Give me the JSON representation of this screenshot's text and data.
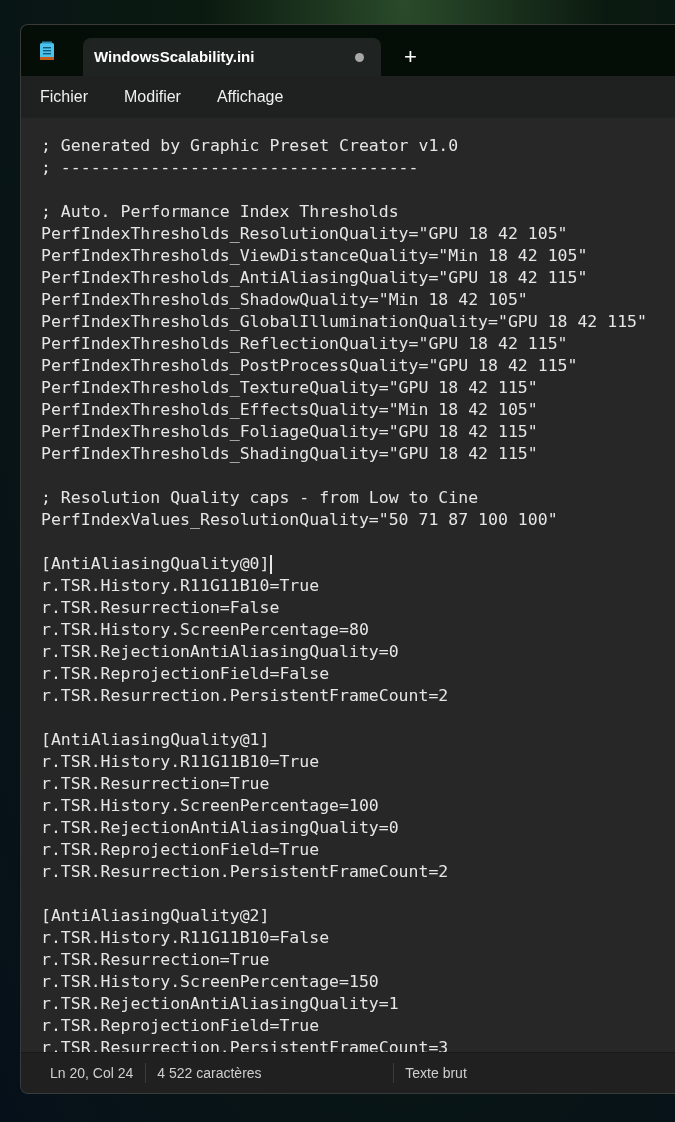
{
  "tabs": [
    {
      "title": "WindowsScalability.ini",
      "selected": true,
      "modified": true
    }
  ],
  "new_tab": "+",
  "menu": [
    "Fichier",
    "Modifier",
    "Affichage"
  ],
  "lines": [
    {
      "kind": "code",
      "text": "; Generated by Graphic Preset Creator v1.0",
      "caret": false
    },
    {
      "kind": "code",
      "text": "; ------------------------------------",
      "caret": false
    },
    {
      "kind": "blank"
    },
    {
      "kind": "code",
      "text": "; Auto. Performance Index Thresholds",
      "caret": false
    },
    {
      "kind": "code",
      "text": "PerfIndexThresholds_ResolutionQuality=\"GPU 18 42 105\"",
      "caret": false
    },
    {
      "kind": "code",
      "text": "PerfIndexThresholds_ViewDistanceQuality=\"Min 18 42 105\"",
      "caret": false
    },
    {
      "kind": "code",
      "text": "PerfIndexThresholds_AntiAliasingQuality=\"GPU 18 42 115\"",
      "caret": false
    },
    {
      "kind": "code",
      "text": "PerfIndexThresholds_ShadowQuality=\"Min 18 42 105\"",
      "caret": false
    },
    {
      "kind": "code",
      "text": "PerfIndexThresholds_GlobalIlluminationQuality=\"GPU 18 42 115\"",
      "caret": false
    },
    {
      "kind": "code",
      "text": "PerfIndexThresholds_ReflectionQuality=\"GPU 18 42 115\"",
      "caret": false
    },
    {
      "kind": "code",
      "text": "PerfIndexThresholds_PostProcessQuality=\"GPU 18 42 115\"",
      "caret": false
    },
    {
      "kind": "code",
      "text": "PerfIndexThresholds_TextureQuality=\"GPU 18 42 115\"",
      "caret": false
    },
    {
      "kind": "code",
      "text": "PerfIndexThresholds_EffectsQuality=\"Min 18 42 105\"",
      "caret": false
    },
    {
      "kind": "code",
      "text": "PerfIndexThresholds_FoliageQuality=\"GPU 18 42 115\"",
      "caret": false
    },
    {
      "kind": "code",
      "text": "PerfIndexThresholds_ShadingQuality=\"GPU 18 42 115\"",
      "caret": false
    },
    {
      "kind": "blank"
    },
    {
      "kind": "code",
      "text": "; Resolution Quality caps - from Low to Cine",
      "caret": false
    },
    {
      "kind": "code",
      "text": "PerfIndexValues_ResolutionQuality=\"50 71 87 100 100\"",
      "caret": false
    },
    {
      "kind": "blank"
    },
    {
      "kind": "code",
      "text": "[AntiAliasingQuality@0]",
      "caret": true
    },
    {
      "kind": "code",
      "text": "r.TSR.History.R11G11B10=True",
      "caret": false
    },
    {
      "kind": "code",
      "text": "r.TSR.Resurrection=False",
      "caret": false
    },
    {
      "kind": "code",
      "text": "r.TSR.History.ScreenPercentage=80",
      "caret": false
    },
    {
      "kind": "code",
      "text": "r.TSR.RejectionAntiAliasingQuality=0",
      "caret": false
    },
    {
      "kind": "code",
      "text": "r.TSR.ReprojectionField=False",
      "caret": false
    },
    {
      "kind": "code",
      "text": "r.TSR.Resurrection.PersistentFrameCount=2",
      "caret": false
    },
    {
      "kind": "blank"
    },
    {
      "kind": "code",
      "text": "[AntiAliasingQuality@1]",
      "caret": false
    },
    {
      "kind": "code",
      "text": "r.TSR.History.R11G11B10=True",
      "caret": false
    },
    {
      "kind": "code",
      "text": "r.TSR.Resurrection=True",
      "caret": false
    },
    {
      "kind": "code",
      "text": "r.TSR.History.ScreenPercentage=100",
      "caret": false
    },
    {
      "kind": "code",
      "text": "r.TSR.RejectionAntiAliasingQuality=0",
      "caret": false
    },
    {
      "kind": "code",
      "text": "r.TSR.ReprojectionField=True",
      "caret": false
    },
    {
      "kind": "code",
      "text": "r.TSR.Resurrection.PersistentFrameCount=2",
      "caret": false
    },
    {
      "kind": "blank"
    },
    {
      "kind": "code",
      "text": "[AntiAliasingQuality@2]",
      "caret": false
    },
    {
      "kind": "code",
      "text": "r.TSR.History.R11G11B10=False",
      "caret": false
    },
    {
      "kind": "code",
      "text": "r.TSR.Resurrection=True",
      "caret": false
    },
    {
      "kind": "code",
      "text": "r.TSR.History.ScreenPercentage=150",
      "caret": false
    },
    {
      "kind": "code",
      "text": "r.TSR.RejectionAntiAliasingQuality=1",
      "caret": false
    },
    {
      "kind": "code",
      "text": "r.TSR.ReprojectionField=True",
      "caret": false
    },
    {
      "kind": "code",
      "text": "r.TSR.Resurrection.PersistentFrameCount=3",
      "caret": false
    }
  ],
  "status_bar": {
    "position": "Ln 20, Col 24",
    "characters": "4 522 caractères",
    "encoding": "Texte brut"
  }
}
